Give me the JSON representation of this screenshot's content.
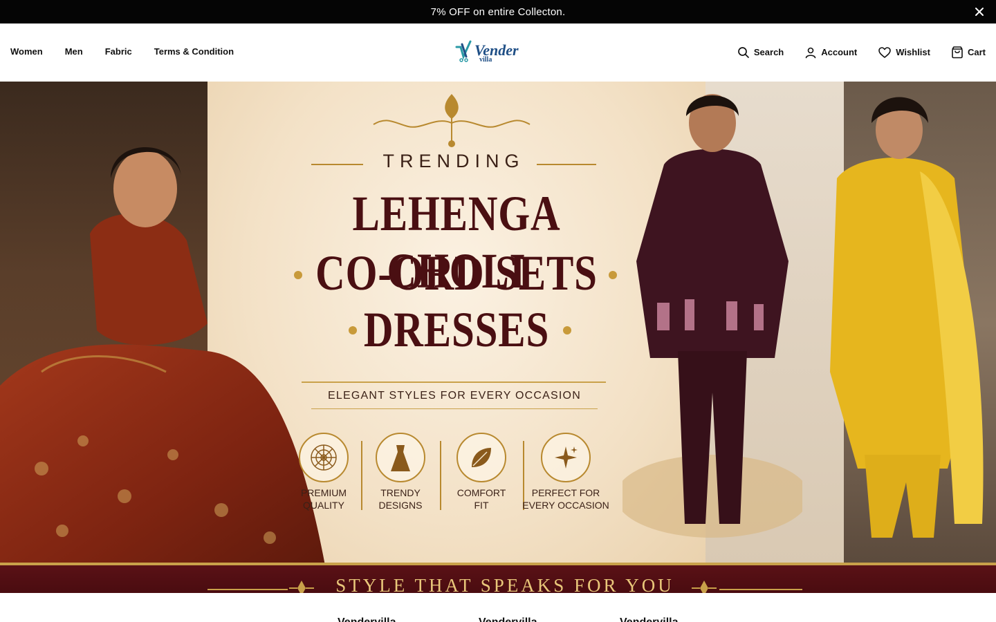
{
  "announcement": {
    "text": "7% OFF on entire Collecton."
  },
  "nav": {
    "left": [
      "Women",
      "Men",
      "Fabric",
      "Terms & Condition"
    ],
    "logo_brand": "Vender",
    "logo_sub": "villa",
    "right": {
      "search": "Search",
      "account": "Account",
      "wishlist": "Wishlist",
      "cart": "Cart"
    }
  },
  "hero": {
    "kicker": "TRENDING",
    "line1": "LEHENGA CHOLI",
    "line2": "CO-ORD SETS",
    "line3": "DRESSES",
    "subtitle": "ELEGANT STYLES FOR EVERY OCCASION",
    "features": [
      {
        "line1": "PREMIUM",
        "line2": "QUALITY",
        "icon": "mandala-icon"
      },
      {
        "line1": "TRENDY",
        "line2": "DESIGNS",
        "icon": "dress-icon"
      },
      {
        "line1": "COMFORT",
        "line2": "FIT",
        "icon": "leaf-icon"
      },
      {
        "line1": "PERFECT FOR",
        "line2": "EVERY OCCASION",
        "icon": "sparkle-icon"
      }
    ],
    "band_text": "STYLE THAT SPEAKS FOR YOU"
  },
  "below": {
    "cards": [
      "Vendervilla",
      "Vendervilla",
      "Vendervilla"
    ]
  },
  "colors": {
    "maroon": "#4a0f12",
    "gold": "#c9a14a",
    "announcement_bg": "#050505",
    "logo_blue": "#1f4f86"
  }
}
